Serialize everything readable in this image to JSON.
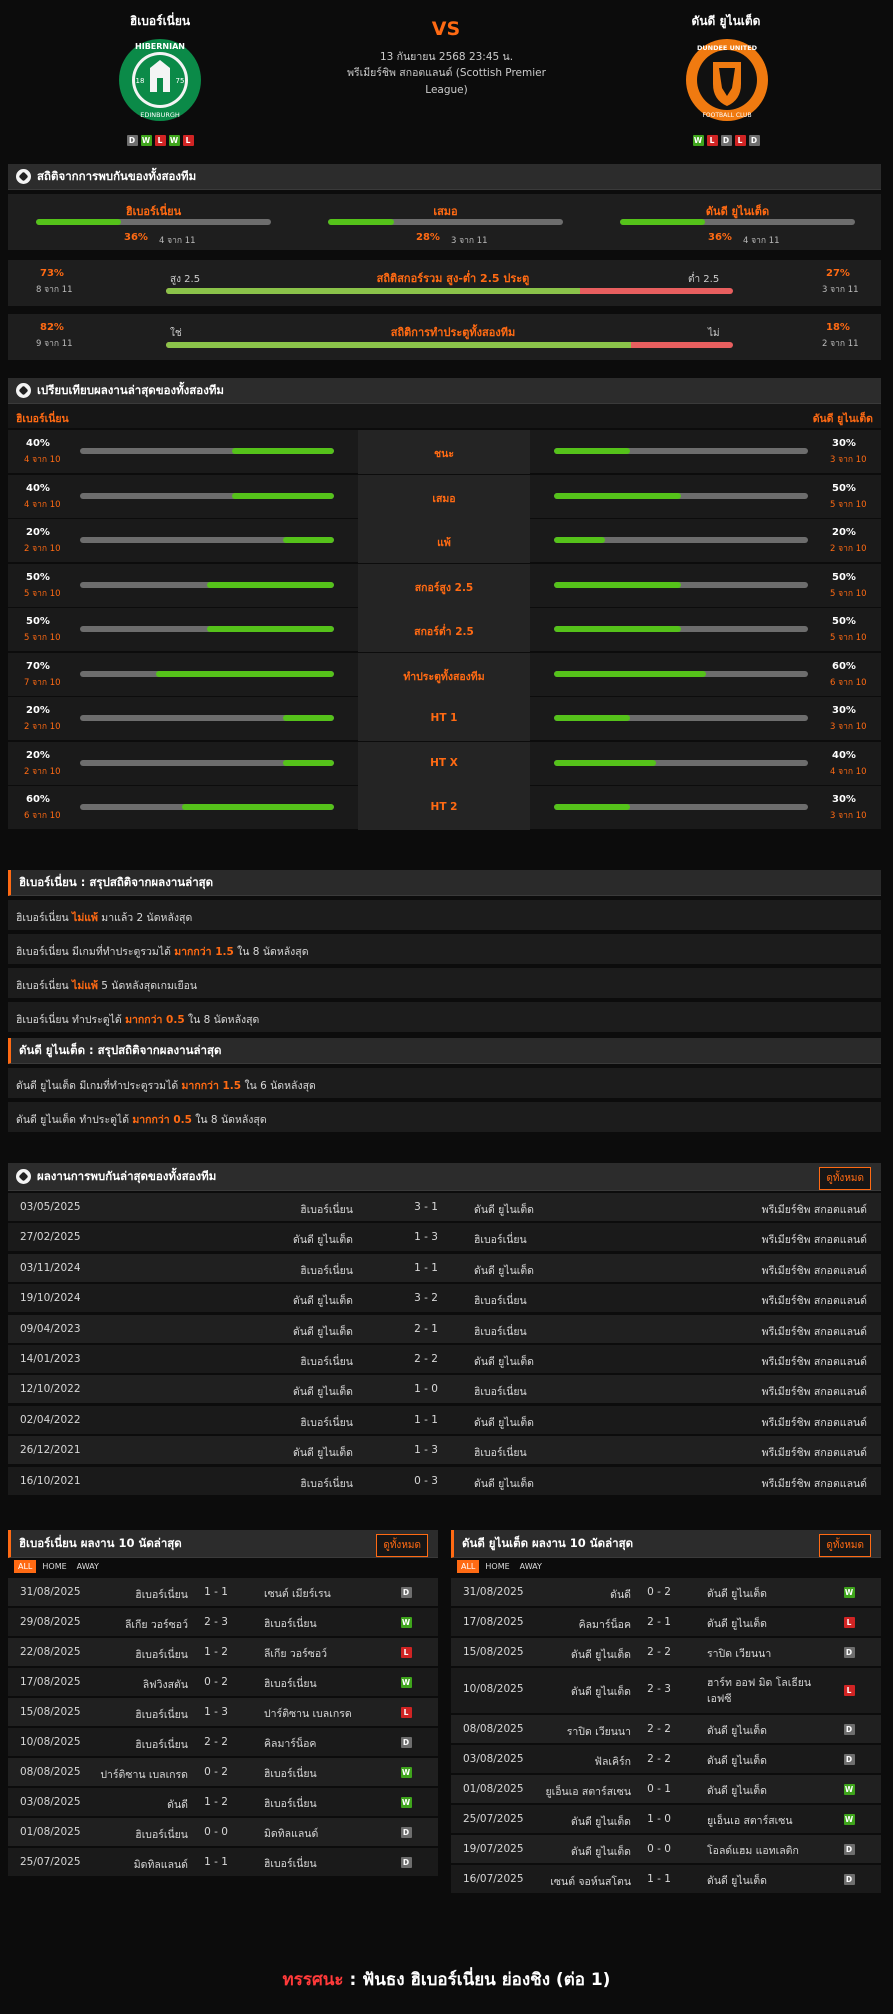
{
  "match": {
    "home": "ฮิเบอร์เนี่ยน",
    "away": "ดันดี ยูไนเต็ด",
    "vs": "VS",
    "datetime": "13 กันยายน 2568 23:45 น.",
    "league": "พรีเมียร์ชิพ สกอตแลนด์ (Scottish Premier League)",
    "home_form": [
      "D",
      "W",
      "L",
      "W",
      "L"
    ],
    "away_form": [
      "W",
      "L",
      "D",
      "L",
      "D"
    ],
    "home_logo_text": [
      "HIBERNIAN",
      "18",
      "75",
      "EDINBURGH"
    ],
    "away_logo_text": [
      "DUNDEE UNITED",
      "FOOTBALL CLUB"
    ]
  },
  "h2h_stats": {
    "title": "สถิติจากการพบกันของทั้งสองทีม",
    "cols": [
      {
        "label": "ฮิเบอร์เนี่ยน",
        "pct": "36%",
        "count": "4 จาก 11",
        "value": 36
      },
      {
        "label": "เสมอ",
        "pct": "28%",
        "count": "3 จาก 11",
        "value": 28
      },
      {
        "label": "ดันดี ยูไนเต็ด",
        "pct": "36%",
        "count": "4 จาก 11",
        "value": 36
      }
    ],
    "ou": {
      "title": "สถิติสกอร์รวม สูง-ต่ำ 2.5 ประตู",
      "left_pct": "73%",
      "left_count": "8 จาก 11",
      "left_label": "สูง 2.5",
      "right_label": "ต่ำ 2.5",
      "right_pct": "27%",
      "right_count": "3 จาก 11",
      "value": 73
    },
    "btts": {
      "title": "สถิติการทำประตูทั้งสองทีม",
      "left_pct": "82%",
      "left_count": "9 จาก 11",
      "left_label": "ใช่",
      "right_label": "ไม่",
      "right_pct": "18%",
      "right_count": "2 จาก 11",
      "value": 82
    }
  },
  "compare": {
    "title": "เปรียบเทียบผลงานล่าสุดของทั้งสองทีม",
    "home": "ฮิเบอร์เนี่ยน",
    "away": "ดันดี ยูไนเต็ด",
    "rows": [
      {
        "label": "ชนะ",
        "hp": "40%",
        "hc": "4 จาก 10",
        "hv": 40,
        "ap": "30%",
        "ac": "3 จาก 10",
        "av": 30
      },
      {
        "label": "เสมอ",
        "hp": "40%",
        "hc": "4 จาก 10",
        "hv": 40,
        "ap": "50%",
        "ac": "5 จาก 10",
        "av": 50
      },
      {
        "label": "แพ้",
        "hp": "20%",
        "hc": "2 จาก 10",
        "hv": 20,
        "ap": "20%",
        "ac": "2 จาก 10",
        "av": 20
      },
      {
        "label": "สกอร์สูง 2.5",
        "hp": "50%",
        "hc": "5 จาก 10",
        "hv": 50,
        "ap": "50%",
        "ac": "5 จาก 10",
        "av": 50
      },
      {
        "label": "สกอร์ต่ำ 2.5",
        "hp": "50%",
        "hc": "5 จาก 10",
        "hv": 50,
        "ap": "50%",
        "ac": "5 จาก 10",
        "av": 50
      },
      {
        "label": "ทำประตูทั้งสองทีม",
        "hp": "70%",
        "hc": "7 จาก 10",
        "hv": 70,
        "ap": "60%",
        "ac": "6 จาก 10",
        "av": 60
      },
      {
        "label": "HT 1",
        "hp": "20%",
        "hc": "2 จาก 10",
        "hv": 20,
        "ap": "30%",
        "ac": "3 จาก 10",
        "av": 30
      },
      {
        "label": "HT X",
        "hp": "20%",
        "hc": "2 จาก 10",
        "hv": 20,
        "ap": "40%",
        "ac": "4 จาก 10",
        "av": 40
      },
      {
        "label": "HT 2",
        "hp": "60%",
        "hc": "6 จาก 10",
        "hv": 60,
        "ap": "30%",
        "ac": "3 จาก 10",
        "av": 30
      }
    ]
  },
  "summary_home": {
    "title": "ฮิเบอร์เนี่ยน : สรุปสถิติจากผลงานล่าสุด",
    "lines": [
      [
        "ฮิเบอร์เนี่ยน ",
        "ไม่แพ้",
        " มาแล้ว 2 นัดหลังสุด"
      ],
      [
        "ฮิเบอร์เนี่ยน มีเกมที่ทำประตูรวมได้ ",
        "มากกว่า 1.5",
        " ใน 8 นัดหลังสุด"
      ],
      [
        "ฮิเบอร์เนี่ยน ",
        "ไม่แพ้",
        " 5 นัดหลังสุดเกมเยือน"
      ],
      [
        "ฮิเบอร์เนี่ยน ทำประตูได้ ",
        "มากกว่า 0.5",
        " ใน 8 นัดหลังสุด"
      ]
    ]
  },
  "summary_away": {
    "title": "ดันดี ยูไนเต็ด : สรุปสถิติจากผลงานล่าสุด",
    "lines": [
      [
        "ดันดี ยูไนเต็ด มีเกมที่ทำประตูรวมได้ ",
        "มากกว่า 1.5",
        " ใน 6 นัดหลังสุด"
      ],
      [
        "ดันดี ยูไนเต็ด ทำประตูได้ ",
        "มากกว่า 0.5",
        " ใน 8 นัดหลังสุด"
      ]
    ]
  },
  "h2h": {
    "title": "ผลงานการพบกันล่าสุดของทั้งสองทีม",
    "view_all": "ดูทั้งหมด",
    "rows": [
      [
        "03/05/2025",
        "ฮิเบอร์เนี่ยน",
        "3 - 1",
        "ดันดี ยูไนเต็ด",
        "พรีเมียร์ชิพ สกอตแลนด์"
      ],
      [
        "27/02/2025",
        "ดันดี ยูไนเต็ด",
        "1 - 3",
        "ฮิเบอร์เนี่ยน",
        "พรีเมียร์ชิพ สกอตแลนด์"
      ],
      [
        "03/11/2024",
        "ฮิเบอร์เนี่ยน",
        "1 - 1",
        "ดันดี ยูไนเต็ด",
        "พรีเมียร์ชิพ สกอตแลนด์"
      ],
      [
        "19/10/2024",
        "ดันดี ยูไนเต็ด",
        "3 - 2",
        "ฮิเบอร์เนี่ยน",
        "พรีเมียร์ชิพ สกอตแลนด์"
      ],
      [
        "09/04/2023",
        "ดันดี ยูไนเต็ด",
        "2 - 1",
        "ฮิเบอร์เนี่ยน",
        "พรีเมียร์ชิพ สกอตแลนด์"
      ],
      [
        "14/01/2023",
        "ฮิเบอร์เนี่ยน",
        "2 - 2",
        "ดันดี ยูไนเต็ด",
        "พรีเมียร์ชิพ สกอตแลนด์"
      ],
      [
        "12/10/2022",
        "ดันดี ยูไนเต็ด",
        "1 - 0",
        "ฮิเบอร์เนี่ยน",
        "พรีเมียร์ชิพ สกอตแลนด์"
      ],
      [
        "02/04/2022",
        "ฮิเบอร์เนี่ยน",
        "1 - 1",
        "ดันดี ยูไนเต็ด",
        "พรีเมียร์ชิพ สกอตแลนด์"
      ],
      [
        "26/12/2021",
        "ดันดี ยูไนเต็ด",
        "1 - 3",
        "ฮิเบอร์เนี่ยน",
        "พรีเมียร์ชิพ สกอตแลนด์"
      ],
      [
        "16/10/2021",
        "ฮิเบอร์เนี่ยน",
        "0 - 3",
        "ดันดี ยูไนเต็ด",
        "พรีเมียร์ชิพ สกอตแลนด์"
      ]
    ]
  },
  "tabs": [
    "ALL",
    "HOME",
    "AWAY"
  ],
  "last_home": {
    "title": "ฮิเบอร์เนี่ยน ผลงาน 10 นัดล่าสุด",
    "view_all": "ดูทั้งหมด",
    "rows": [
      [
        "31/08/2025",
        "ฮิเบอร์เนี่ยน",
        "1 - 1",
        "เซนต์ เมียร์เรน",
        "D"
      ],
      [
        "29/08/2025",
        "ลีเกีย วอร์ซอว์",
        "2 - 3",
        "ฮิเบอร์เนี่ยน",
        "W"
      ],
      [
        "22/08/2025",
        "ฮิเบอร์เนี่ยน",
        "1 - 2",
        "ลีเกีย วอร์ซอว์",
        "L"
      ],
      [
        "17/08/2025",
        "ลิฟวิงสตัน",
        "0 - 2",
        "ฮิเบอร์เนี่ยน",
        "W"
      ],
      [
        "15/08/2025",
        "ฮิเบอร์เนี่ยน",
        "1 - 3",
        "ปาร์ติซาน เบลเกรด",
        "L"
      ],
      [
        "10/08/2025",
        "ฮิเบอร์เนี่ยน",
        "2 - 2",
        "คิลมาร์น็อค",
        "D"
      ],
      [
        "08/08/2025",
        "ปาร์ติซาน เบลเกรด",
        "0 - 2",
        "ฮิเบอร์เนี่ยน",
        "W"
      ],
      [
        "03/08/2025",
        "ดันดี",
        "1 - 2",
        "ฮิเบอร์เนี่ยน",
        "W"
      ],
      [
        "01/08/2025",
        "ฮิเบอร์เนี่ยน",
        "0 - 0",
        "มิดทิลแลนด์",
        "D"
      ],
      [
        "25/07/2025",
        "มิดทิลแลนด์",
        "1 - 1",
        "ฮิเบอร์เนี่ยน",
        "D"
      ]
    ]
  },
  "last_away": {
    "title": "ดันดี ยูไนเต็ด ผลงาน 10 นัดล่าสุด",
    "view_all": "ดูทั้งหมด",
    "rows": [
      [
        "31/08/2025",
        "ดันดี",
        "0 - 2",
        "ดันดี ยูไนเต็ด",
        "W"
      ],
      [
        "17/08/2025",
        "คิลมาร์น็อค",
        "2 - 1",
        "ดันดี ยูไนเต็ด",
        "L"
      ],
      [
        "15/08/2025",
        "ดันดี ยูไนเต็ด",
        "2 - 2",
        "ราปิด เวียนนา",
        "D"
      ],
      [
        "10/08/2025",
        "ดันดี ยูไนเต็ด",
        "2 - 3",
        "ฮาร์ท ออฟ มิด โลเธียน เอฟซี",
        "L"
      ],
      [
        "08/08/2025",
        "ราปิด เวียนนา",
        "2 - 2",
        "ดันดี ยูไนเต็ด",
        "D"
      ],
      [
        "03/08/2025",
        "ฟัลเคิร์ก",
        "2 - 2",
        "ดันดี ยูไนเต็ด",
        "D"
      ],
      [
        "01/08/2025",
        "ยูเอ็นเอ สตาร์สเซน",
        "0 - 1",
        "ดันดี ยูไนเต็ด",
        "W"
      ],
      [
        "25/07/2025",
        "ดันดี ยูไนเต็ด",
        "1 - 0",
        "ยูเอ็นเอ สตาร์สเซน",
        "W"
      ],
      [
        "19/07/2025",
        "ดันดี ยูไนเต็ด",
        "0 - 0",
        "โอลด์แฮม แอทเลติก",
        "D"
      ],
      [
        "16/07/2025",
        "เซนต์ จอห์นสโตน",
        "1 - 1",
        "ดันดี ยูไนเต็ด",
        "D"
      ]
    ]
  },
  "prediction": {
    "label": "ทรรศนะ",
    "colon": " : ",
    "text": "ฟันธง ฮิเบอร์เนี่ยน ย่องชิง (ต่อ 1)"
  },
  "colors": {
    "accent": "#ff6a13",
    "win": "#3fa51c",
    "loss": "#d12424",
    "draw": "#6e6e6e",
    "bar_fill": "#55c21a",
    "bar_red": "#e85f5f"
  }
}
